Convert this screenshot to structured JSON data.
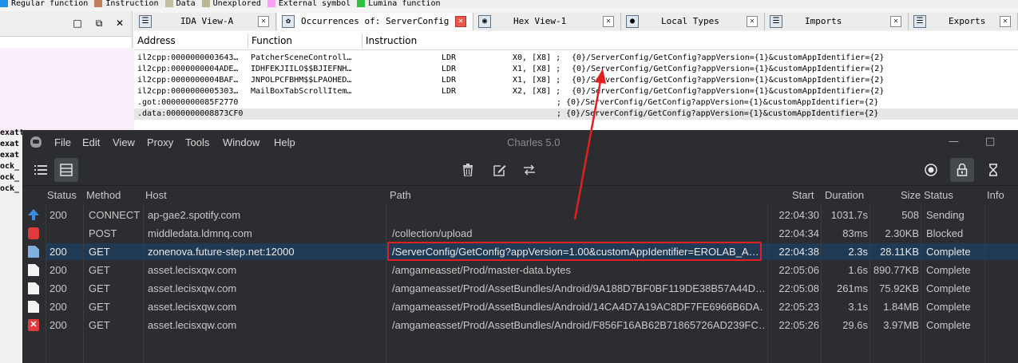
{
  "ida": {
    "legend": [
      {
        "label": "Regular function",
        "color": "#1e8ee8"
      },
      {
        "label": "Instruction",
        "color": "#c08060"
      },
      {
        "label": "Data",
        "color": "#bfbf9f"
      },
      {
        "label": "Unexplored",
        "color": "#b8b890"
      },
      {
        "label": "External symbol",
        "color": "#f8a0f8"
      },
      {
        "label": "Lumina function",
        "color": "#30c040"
      }
    ],
    "left_pane": {
      "window_buttons": [
        "□",
        "⧉",
        "✕"
      ],
      "names": [
        "exatt",
        "exat",
        "exat",
        "ock_",
        "ock_",
        "ock_"
      ]
    },
    "tabs": [
      {
        "label": "IDA View-A",
        "icon": "ida-view-icon",
        "glyph": "☰"
      },
      {
        "label": "Occurrences of: ServerConfig",
        "icon": "occurrences-icon",
        "glyph": "✿",
        "active": true
      },
      {
        "label": "Hex View-1",
        "icon": "hex-view-icon",
        "glyph": "◉"
      },
      {
        "label": "Local Types",
        "icon": "local-types-icon",
        "glyph": "●"
      },
      {
        "label": "Imports",
        "icon": "imports-icon",
        "glyph": "☰"
      },
      {
        "label": "Exports",
        "icon": "exports-icon",
        "glyph": "☰"
      }
    ],
    "occurrences": {
      "columns": [
        "Address",
        "Function",
        "Instruction"
      ],
      "rows": [
        {
          "address": "il2cpp:0000000003643…",
          "function": "PatcherSceneControll…",
          "mnemonic": "LDR",
          "operands": "X0, [X8] ;",
          "comment": "{0}/ServerConfig/GetConfig?appVersion={1}&customAppIdentifier={2}"
        },
        {
          "address": "il2cpp:0000000004ADE…",
          "function": "IDHFEKJIILO$$BJIEFNH…",
          "mnemonic": "LDR",
          "operands": "X1, [X8] ;",
          "comment": "{0}/ServerConfig/GetConfig?appVersion={1}&customAppIdentifier={2}"
        },
        {
          "address": "il2cpp:0000000004BAF…",
          "function": "JNPOLPCFBHM$$LPAOHED…",
          "mnemonic": "LDR",
          "operands": "X1, [X8] ;",
          "comment": "{0}/ServerConfig/GetConfig?appVersion={1}&customAppIdentifier={2}"
        },
        {
          "address": "il2cpp:0000000005303…",
          "function": "MailBoxTabScrollItem…",
          "mnemonic": "LDR",
          "operands": "X2, [X8] ;",
          "comment": "{0}/ServerConfig/GetConfig?appVersion={1}&customAppIdentifier={2}"
        },
        {
          "address": ".got:00000000085F2770",
          "function": "",
          "mnemonic": "",
          "operands": ";",
          "comment": "{0}/ServerConfig/GetConfig?appVersion={1}&customAppIdentifier={2}"
        },
        {
          "address": ".data:0000000008873CF0",
          "function": "",
          "mnemonic": "",
          "operands": ";",
          "comment": "{0}/ServerConfig/GetConfig?appVersion={1}&customAppIdentifier={2}",
          "selected": true
        }
      ]
    }
  },
  "charles": {
    "title": "Charles 5.0",
    "menu": [
      "File",
      "Edit",
      "View",
      "Proxy",
      "Tools",
      "Window",
      "Help"
    ],
    "window_buttons": [
      "—",
      "□"
    ],
    "columns": [
      "Status",
      "Method",
      "Host",
      "Path",
      "Start",
      "Duration",
      "Size",
      "Status",
      "Info"
    ],
    "rows": [
      {
        "icon": "up",
        "status": "200",
        "method": "CONNECT",
        "host": "ap-gae2.spotify.com",
        "path": "",
        "start": "22:04:30",
        "duration": "1031.7s",
        "size": "508",
        "state": "Sending"
      },
      {
        "icon": "block",
        "status": "",
        "method": "POST",
        "host": "middledata.ldmnq.com",
        "path": "/collection/upload",
        "start": "22:04:34",
        "duration": "83ms",
        "size": "2.30KB",
        "state": "Blocked"
      },
      {
        "icon": "doc-hi",
        "status": "200",
        "method": "GET",
        "host": "zonenova.future-step.net:12000",
        "path": "/ServerConfig/GetConfig?appVersion=1.00&customAppIdentifier=EROLAB_A…",
        "start": "22:04:38",
        "duration": "2.3s",
        "size": "28.11KB",
        "state": "Complete",
        "selected": true
      },
      {
        "icon": "doc",
        "status": "200",
        "method": "GET",
        "host": "asset.lecisxqw.com",
        "path": "/amgameasset/Prod/master-data.bytes",
        "start": "22:05:06",
        "duration": "1.6s",
        "size": "890.77KB",
        "state": "Complete"
      },
      {
        "icon": "doc",
        "status": "200",
        "method": "GET",
        "host": "asset.lecisxqw.com",
        "path": "/amgameasset/Prod/AssetBundles/Android/9A188D7BF0BF119DE38B57A44D…",
        "start": "22:05:08",
        "duration": "261ms",
        "size": "75.92KB",
        "state": "Complete"
      },
      {
        "icon": "doc",
        "status": "200",
        "method": "GET",
        "host": "asset.lecisxqw.com",
        "path": "/amgameasset/Prod/AssetBundles/Android/14CA4D7A19AC8DF7FE6966B6DA…",
        "start": "22:05:23",
        "duration": "3.1s",
        "size": "1.84MB",
        "state": "Complete"
      },
      {
        "icon": "err",
        "status": "200",
        "method": "GET",
        "host": "asset.lecisxqw.com",
        "path": "/amgameasset/Prod/AssetBundles/Android/F856F16AB62B71865726AD239FC…",
        "start": "22:05:26",
        "duration": "29.6s",
        "size": "3.97MB",
        "state": "Complete"
      }
    ]
  },
  "colors": {
    "annotation_red": "#e02020",
    "charles_bg": "#2b2d30",
    "selection": "#203a55"
  }
}
